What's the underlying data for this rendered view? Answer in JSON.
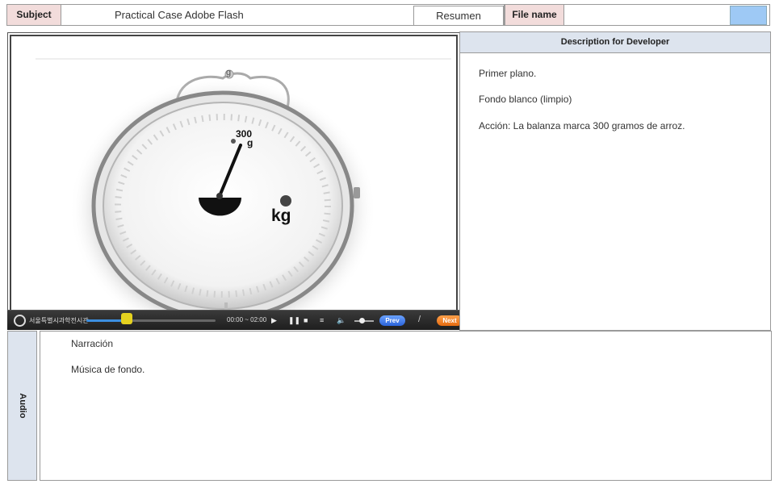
{
  "header": {
    "subject_label": "Subject",
    "subject_value": "Practical Case Adobe Flash",
    "resumen_label": "Resumen",
    "file_name_label": "File name",
    "file_name_value": ""
  },
  "scale_image": {
    "reading": "300",
    "reading_unit": "g",
    "top_mark": "g",
    "unit": "kg",
    "needle_value_g": 300
  },
  "player": {
    "brand": "서울특별시과학전시관",
    "time": "00:00 ~ 02:00",
    "progress": 0.35,
    "volume": 0.5,
    "play_icon": "play-icon",
    "pause_icon": "pause-icon",
    "stop_icon": "stop-icon",
    "menu_icon": "menu-icon",
    "volume_icon": "volume-icon",
    "prev_label": "Prev",
    "separator": "/",
    "next_label": "Next"
  },
  "description": {
    "header": "Description for Developer",
    "lines": [
      "Primer plano.",
      "Fondo blanco (limpio)",
      "Acción: La balanza marca 300 gramos de arroz."
    ]
  },
  "audio": {
    "label": "Audio",
    "lines": [
      "Narración",
      "Música de fondo."
    ]
  },
  "colors": {
    "label_pink": "#f2dcdb",
    "header_blue": "#dde4ee",
    "swatch_blue": "#9ec9f5",
    "prev_blue": "#2b63d8",
    "next_orange": "#e56b10"
  }
}
